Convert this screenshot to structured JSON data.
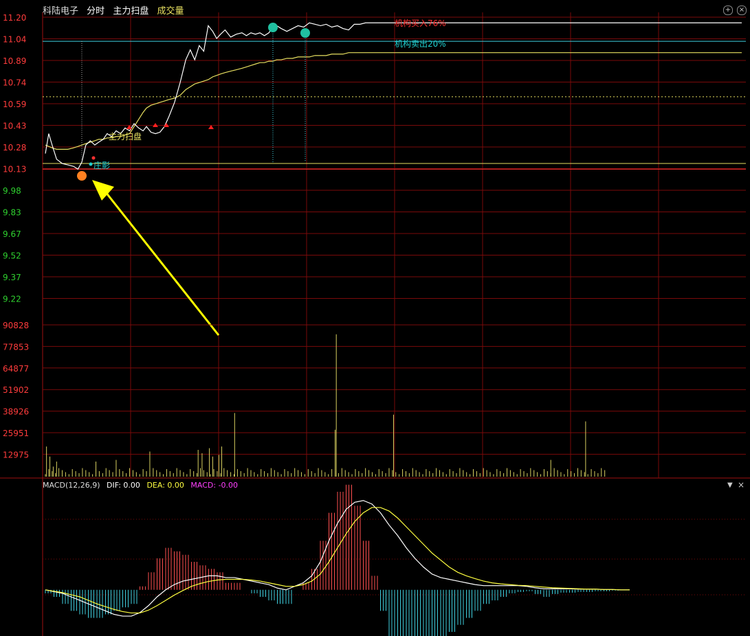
{
  "header": {
    "stock_name": "科陆电子",
    "mode": "分时",
    "indicator": "主力扫盘",
    "volume_label": "成交量"
  },
  "macd": {
    "title": "MACD(12,26,9)",
    "dif": "DIF: 0.00",
    "dea": "DEA: 0.00",
    "macd": "MACD: -0.00",
    "menu_icon": "chevron-down-icon"
  },
  "controls": {
    "zoom_in_icon": "plus-icon",
    "close_icon": "close-icon"
  },
  "annotations": {
    "main_scan": "主力扫盘",
    "banker_shadow": "庄影",
    "inst_buy": "机构买入76%",
    "inst_sell": "机构卖出20%"
  },
  "colors": {
    "background": "#000000",
    "grid": "#7a0a0a",
    "price_line": "#ffffff",
    "avg_line": "#e8e060",
    "up": "#ff3030",
    "down": "#20c0c0",
    "axis_up": "#ff3c3c",
    "axis_down": "#2fd02f",
    "volume": "#d8d060",
    "arrow": "#ffff00",
    "dea_line": "#ffff40",
    "macd_label": "#ff40ff"
  },
  "chart_data": [
    {
      "type": "line",
      "name": "price",
      "y_ticks": [
        "11.20",
        "11.04",
        "10.89",
        "10.74",
        "10.59",
        "10.43",
        "10.28",
        "10.13",
        "9.98",
        "9.83",
        "9.67",
        "9.52",
        "9.37",
        "9.22"
      ],
      "ylim": [
        9.14,
        11.2
      ],
      "prev_close": 10.13,
      "x": [
        0,
        6,
        12,
        20,
        30,
        40,
        50,
        58,
        65,
        72,
        80,
        88,
        95,
        103,
        110,
        118,
        126,
        134,
        142,
        150,
        158,
        166,
        174,
        180,
        188,
        196,
        204,
        212,
        220,
        230,
        240,
        250,
        258,
        266,
        274,
        282,
        290,
        298,
        305,
        312,
        320,
        330,
        340,
        350,
        358,
        366,
        374,
        382,
        390,
        398,
        405,
        412,
        420,
        430,
        440,
        450,
        460,
        470,
        480,
        490,
        500,
        510,
        520,
        530,
        540,
        550,
        560,
        570,
        575,
        582,
        590,
        600,
        610,
        620,
        630,
        640,
        650,
        660,
        670,
        680,
        690,
        700,
        720,
        760,
        800,
        850,
        900,
        950,
        1000,
        1040,
        1065,
        1090,
        1120,
        1170,
        1200,
        1210,
        1230,
        1240
      ],
      "price": [
        10.24,
        10.38,
        10.3,
        10.2,
        10.17,
        10.16,
        10.15,
        10.13,
        10.18,
        10.3,
        10.33,
        10.3,
        10.32,
        10.34,
        10.38,
        10.36,
        10.4,
        10.38,
        10.42,
        10.4,
        10.45,
        10.42,
        10.4,
        10.43,
        10.39,
        10.38,
        10.39,
        10.43,
        10.5,
        10.6,
        10.74,
        10.9,
        10.97,
        10.9,
        11.0,
        10.96,
        11.14,
        11.1,
        11.05,
        11.08,
        11.11,
        11.06,
        11.08,
        11.09,
        11.07,
        11.09,
        11.08,
        11.09,
        11.07,
        11.09,
        11.13,
        11.14,
        11.12,
        11.1,
        11.12,
        11.14,
        11.13,
        11.16,
        11.15,
        11.14,
        11.15,
        11.13,
        11.14,
        11.12,
        11.11,
        11.15,
        11.15,
        11.16,
        11.16,
        11.16,
        11.16,
        11.16,
        11.16,
        11.16,
        11.16,
        11.16,
        11.16,
        11.16,
        11.16,
        11.16,
        11.16,
        11.16,
        11.16,
        11.16,
        11.16,
        11.16,
        11.16,
        11.16,
        11.16,
        11.16,
        11.16,
        11.16,
        11.16,
        11.16,
        11.16,
        11.16,
        11.16,
        11.16
      ],
      "avg": [
        10.3,
        10.29,
        10.28,
        10.27,
        10.27,
        10.27,
        10.28,
        10.29,
        10.3,
        10.31,
        10.32,
        10.33,
        10.34,
        10.34,
        10.35,
        10.35,
        10.36,
        10.36,
        10.37,
        10.38,
        10.43,
        10.48,
        10.53,
        10.56,
        10.58,
        10.59,
        10.6,
        10.61,
        10.62,
        10.63,
        10.65,
        10.69,
        10.71,
        10.73,
        10.74,
        10.75,
        10.76,
        10.78,
        10.79,
        10.8,
        10.81,
        10.82,
        10.83,
        10.84,
        10.85,
        10.86,
        10.87,
        10.88,
        10.88,
        10.89,
        10.89,
        10.9,
        10.9,
        10.91,
        10.91,
        10.92,
        10.92,
        10.92,
        10.93,
        10.93,
        10.93,
        10.94,
        10.94,
        10.94,
        10.95,
        10.95,
        10.95,
        10.95,
        10.95,
        10.95,
        10.95,
        10.95,
        10.95,
        10.95,
        10.95,
        10.95,
        10.95,
        10.95,
        10.95,
        10.95,
        10.95,
        10.95,
        10.95,
        10.95,
        10.95,
        10.95,
        10.95,
        10.95,
        10.95,
        10.95,
        10.95,
        10.95,
        10.95,
        10.95,
        10.95,
        10.95,
        10.95,
        10.95
      ]
    },
    {
      "type": "bar",
      "name": "volume",
      "y_ticks": [
        "90828",
        "77853",
        "64877",
        "51902",
        "38926",
        "25951",
        "12975"
      ],
      "ylim": [
        0,
        98000
      ],
      "spikes": [
        {
          "x": 2,
          "v": 18000
        },
        {
          "x": 8,
          "v": 12000
        },
        {
          "x": 14,
          "v": 6000
        },
        {
          "x": 20,
          "v": 9000
        },
        {
          "x": 90,
          "v": 9000
        },
        {
          "x": 126,
          "v": 10000
        },
        {
          "x": 186,
          "v": 15000
        },
        {
          "x": 272,
          "v": 16000
        },
        {
          "x": 279,
          "v": 14000
        },
        {
          "x": 292,
          "v": 17000
        },
        {
          "x": 298,
          "v": 12000
        },
        {
          "x": 309,
          "v": 13000
        },
        {
          "x": 314,
          "v": 18000
        },
        {
          "x": 337,
          "v": 38000
        },
        {
          "x": 516,
          "v": 28000
        },
        {
          "x": 518,
          "v": 85000
        },
        {
          "x": 620,
          "v": 37000
        },
        {
          "x": 900,
          "v": 10000
        },
        {
          "x": 962,
          "v": 33000
        }
      ]
    },
    {
      "type": "line",
      "name": "macd",
      "x_ticks": [],
      "ylim": [
        -0.12,
        0.28
      ],
      "dif": [
        0.0,
        -0.005,
        -0.01,
        -0.02,
        -0.03,
        -0.04,
        -0.05,
        -0.06,
        -0.07,
        -0.075,
        -0.075,
        -0.065,
        -0.045,
        -0.02,
        0.0,
        0.015,
        0.025,
        0.03,
        0.035,
        0.04,
        0.04,
        0.035,
        0.035,
        0.03,
        0.025,
        0.02,
        0.015,
        0.005,
        0.0,
        0.01,
        0.02,
        0.04,
        0.08,
        0.14,
        0.19,
        0.23,
        0.25,
        0.255,
        0.245,
        0.22,
        0.185,
        0.155,
        0.12,
        0.09,
        0.065,
        0.045,
        0.035,
        0.03,
        0.025,
        0.02,
        0.015,
        0.012,
        0.012,
        0.012,
        0.012,
        0.012,
        0.01,
        0.006,
        0.003,
        0.003,
        0.003,
        0.003,
        0.002,
        0.002,
        0.002,
        0.001,
        0.001,
        0.0,
        0.0
      ],
      "dea": [
        0.0,
        -0.004,
        -0.008,
        -0.014,
        -0.02,
        -0.03,
        -0.04,
        -0.048,
        -0.056,
        -0.062,
        -0.066,
        -0.066,
        -0.058,
        -0.045,
        -0.03,
        -0.015,
        -0.002,
        0.01,
        0.018,
        0.024,
        0.028,
        0.03,
        0.03,
        0.03,
        0.028,
        0.025,
        0.02,
        0.015,
        0.01,
        0.01,
        0.015,
        0.025,
        0.045,
        0.08,
        0.12,
        0.16,
        0.195,
        0.22,
        0.235,
        0.235,
        0.225,
        0.205,
        0.18,
        0.155,
        0.13,
        0.105,
        0.085,
        0.065,
        0.05,
        0.04,
        0.032,
        0.025,
        0.02,
        0.017,
        0.015,
        0.013,
        0.012,
        0.01,
        0.008,
        0.006,
        0.005,
        0.004,
        0.003,
        0.002,
        0.002,
        0.001,
        0.001,
        0.0,
        0.0
      ],
      "hist": [
        -0.005,
        -0.01,
        -0.02,
        -0.03,
        -0.035,
        -0.04,
        -0.04,
        -0.035,
        -0.03,
        -0.025,
        -0.02,
        0.005,
        0.025,
        0.045,
        0.06,
        0.055,
        0.05,
        0.04,
        0.035,
        0.03,
        0.025,
        0.01,
        0.01,
        0.0,
        -0.005,
        -0.01,
        -0.015,
        -0.02,
        -0.02,
        0.0,
        0.01,
        0.03,
        0.07,
        0.11,
        0.14,
        0.15,
        0.12,
        0.07,
        0.02,
        -0.03,
        -0.07,
        -0.09,
        -0.1,
        -0.1,
        -0.09,
        -0.08,
        -0.07,
        -0.06,
        -0.05,
        -0.04,
        -0.03,
        -0.02,
        -0.015,
        -0.01,
        -0.005,
        -0.003,
        -0.002,
        -0.006,
        -0.01,
        -0.006,
        -0.004,
        -0.004,
        -0.003,
        -0.003,
        -0.002,
        -0.002,
        -0.001,
        0.0,
        0.0
      ]
    }
  ]
}
